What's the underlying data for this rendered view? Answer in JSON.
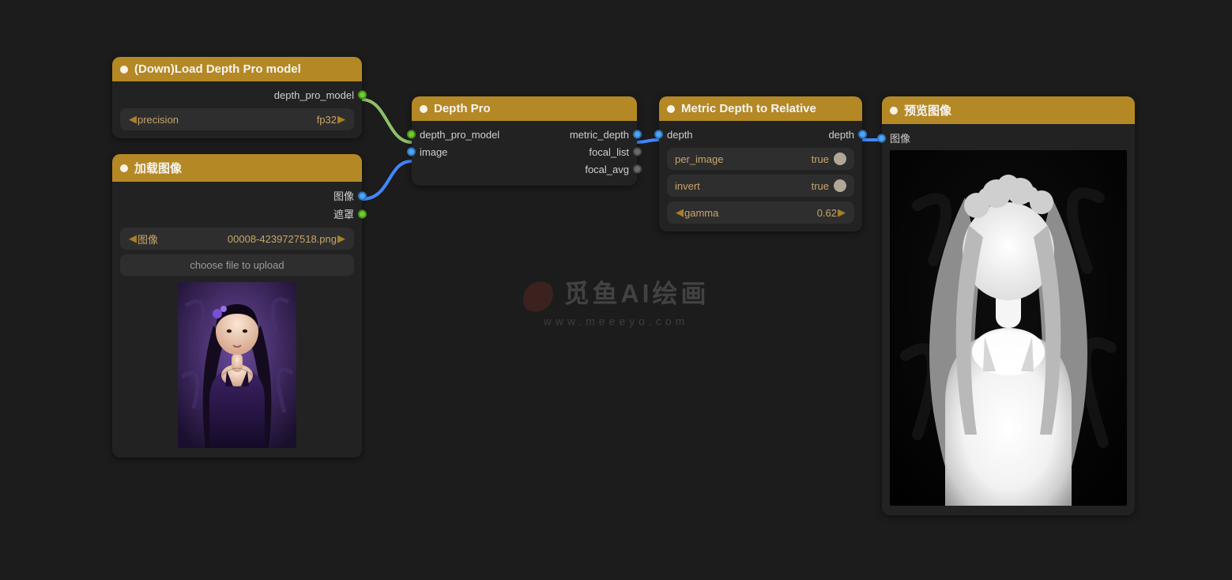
{
  "watermark": {
    "cn": "觅鱼AI绘画",
    "url": "www.meeeyo.com"
  },
  "nodes": {
    "load_model": {
      "title": "(Down)Load Depth Pro model",
      "outputs": {
        "model": "depth_pro_model"
      },
      "widgets": {
        "precision_label": "precision",
        "precision_value": "fp32"
      }
    },
    "load_image": {
      "title": "加载图像",
      "outputs": {
        "image": "图像",
        "mask": "遮罩"
      },
      "widgets": {
        "image_label": "图像",
        "image_value": "00008-4239727518.png",
        "upload_label": "choose file to upload"
      }
    },
    "depth_pro": {
      "title": "Depth Pro",
      "inputs": {
        "model": "depth_pro_model",
        "image": "image"
      },
      "outputs": {
        "metric_depth": "metric_depth",
        "focal_list": "focal_list",
        "focal_avg": "focal_avg"
      }
    },
    "metric_to_rel": {
      "title": "Metric Depth to Relative",
      "inputs": {
        "depth": "depth"
      },
      "outputs": {
        "depth": "depth"
      },
      "widgets": {
        "per_image_label": "per_image",
        "per_image_value": "true",
        "invert_label": "invert",
        "invert_value": "true",
        "gamma_label": "gamma",
        "gamma_value": "0.62"
      }
    },
    "preview": {
      "title": "预览图像",
      "inputs": {
        "image": "图像"
      }
    }
  }
}
